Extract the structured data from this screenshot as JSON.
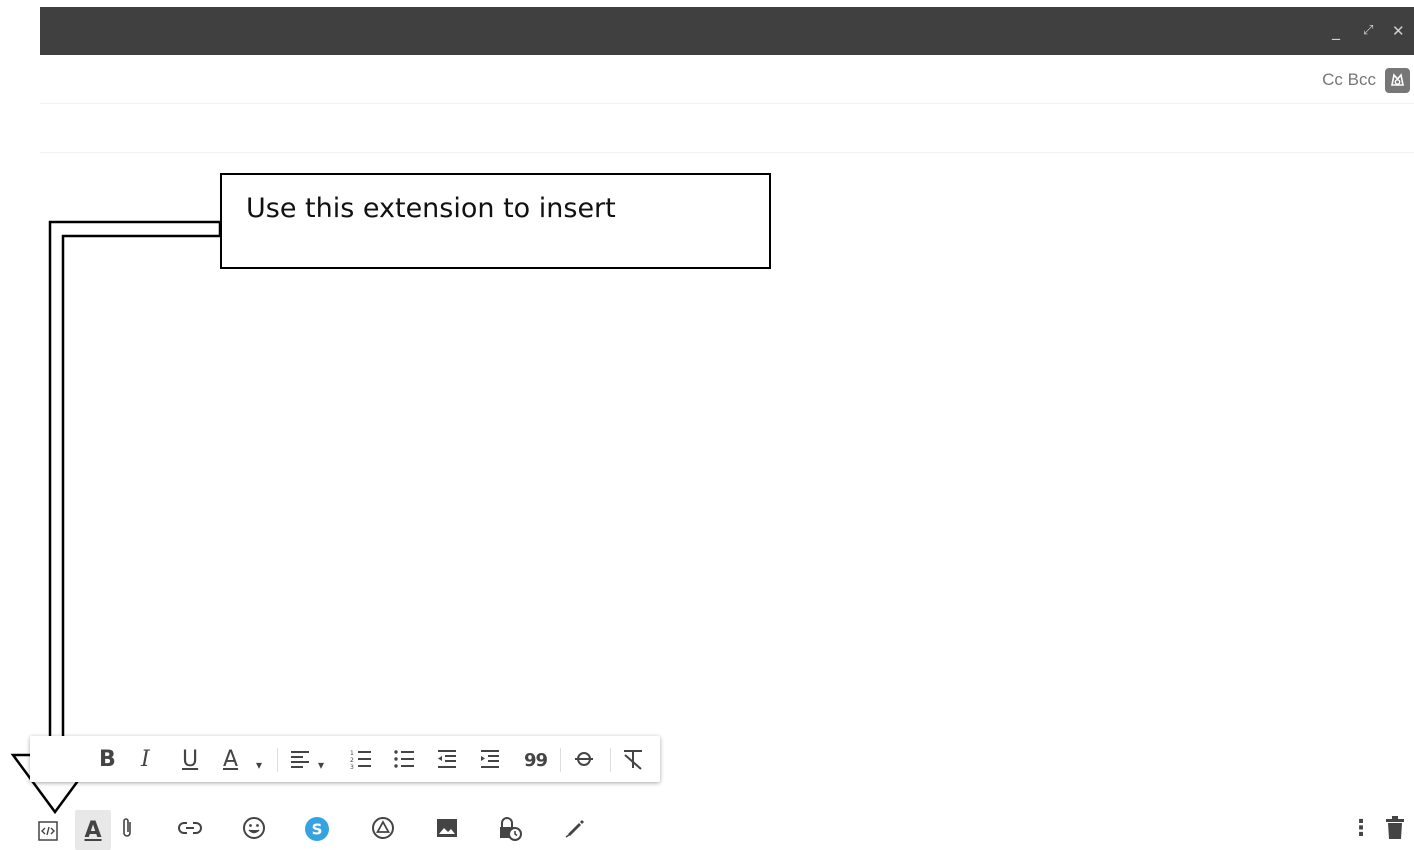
{
  "window": {
    "minimize_glyph": "_",
    "expand_glyph": "⤢",
    "close_glyph": "✕"
  },
  "recipients": {
    "cc_bcc_label": "Cc Bcc"
  },
  "callout": {
    "text": "Use this extension to insert"
  },
  "format_toolbar": {
    "bold": "B",
    "italic": "I",
    "underline": "U",
    "text_color": "A",
    "dropdown": "▾",
    "quote": "99"
  },
  "bottom_toolbar": {
    "formatting": "A",
    "more": "⋮"
  },
  "icons": [
    "code-snippet-icon",
    "text-formatting-icon",
    "attach-icon",
    "link-icon",
    "emoji-icon",
    "extension-s-icon",
    "drive-icon",
    "photo-icon",
    "confidential-mode-icon",
    "signature-icon",
    "more-options-icon",
    "trash-icon"
  ],
  "colors": {
    "titlebar": "#404040",
    "extension_blue": "#36a3e0"
  }
}
